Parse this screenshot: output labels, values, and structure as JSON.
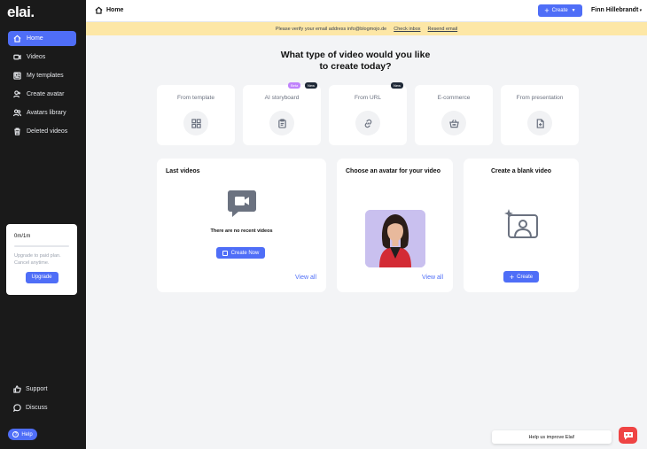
{
  "sidebar": {
    "logo": "elai.",
    "items": [
      {
        "label": "Home",
        "icon": "home-icon"
      },
      {
        "label": "Videos",
        "icon": "video-icon"
      },
      {
        "label": "My templates",
        "icon": "templates-icon"
      },
      {
        "label": "Create avatar",
        "icon": "add-user-icon"
      },
      {
        "label": "Avatars library",
        "icon": "users-icon"
      },
      {
        "label": "Deleted videos",
        "icon": "trash-icon"
      }
    ],
    "plan": {
      "usage": "0m/1m",
      "text": "Upgrade to paid plan. Cancel anytime.",
      "button": "Upgrade"
    },
    "bottom": [
      {
        "label": "Support",
        "icon": "thumbs-up-icon"
      },
      {
        "label": "Discuss",
        "icon": "chat-icon"
      }
    ],
    "help": "Help"
  },
  "header": {
    "title": "Home",
    "create_label": "Create",
    "user": "Finn Hillebrandt"
  },
  "banner": {
    "text": "Please verify your email address info@blogmojo.de",
    "check_inbox": "Check inbox",
    "resend": "Resend email"
  },
  "main": {
    "title": "What type of video would you like to create today?",
    "types": [
      {
        "label": "From template",
        "icon": "grid-icon"
      },
      {
        "label": "AI storyboard",
        "icon": "clipboard-icon",
        "badges": [
          "Beta",
          "New"
        ]
      },
      {
        "label": "From URL",
        "icon": "link-icon",
        "badges": [
          "New"
        ]
      },
      {
        "label": "E-commerce",
        "icon": "basket-icon"
      },
      {
        "label": "From presentation",
        "icon": "file-plus-icon"
      }
    ],
    "last_videos": {
      "title": "Last videos",
      "empty": "There are no recent videos",
      "button": "Create Now",
      "view_all": "View all"
    },
    "avatar_card": {
      "title": "Choose an avatar for your video",
      "view_all": "View all"
    },
    "blank_card": {
      "title": "Create a blank video",
      "button": "Create"
    }
  },
  "footer": {
    "improve": "Help us improve Elai!"
  },
  "colors": {
    "accent": "#4f6ef7",
    "sidebar": "#1a1a1a",
    "banner": "#fde7a6"
  }
}
